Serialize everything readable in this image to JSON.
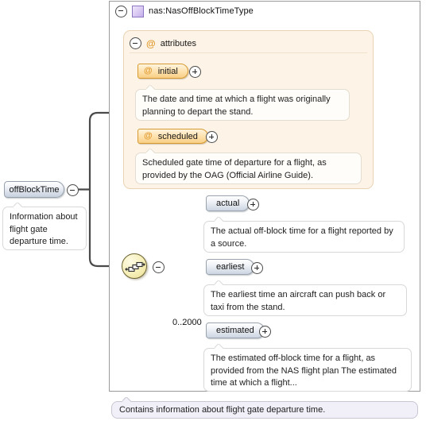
{
  "diagram": {
    "kind": "xsd-schema-diagram",
    "root_element": {
      "name": "offBlockTime",
      "documentation": "Information about flight gate departure time.",
      "toggle": "minus"
    },
    "type_box": {
      "title": "nas:NasOffBlockTimeType",
      "icon": "complex-type-icon",
      "toggle": "minus",
      "footer_documentation": "Contains information about flight gate departure time."
    },
    "attributes_group": {
      "label": "attributes",
      "toggle": "minus",
      "icon": "at-sign-icon",
      "items": [
        {
          "name": "initial",
          "toggle": "plus",
          "documentation": "The date and time at which a flight was originally planning to depart the stand."
        },
        {
          "name": "scheduled",
          "toggle": "plus",
          "documentation": "Scheduled gate time of departure for a flight, as provided by the OAG (Official Airline Guide)."
        }
      ]
    },
    "sequence": {
      "icon": "sequence-compositor-icon",
      "toggle": "minus",
      "occurrence": "0..2000",
      "children": [
        {
          "name": "actual",
          "toggle": "plus",
          "documentation": "The actual off-block time for a flight reported by a source."
        },
        {
          "name": "earliest",
          "toggle": "plus",
          "documentation": "The earliest time an aircraft can push back or taxi from the stand."
        },
        {
          "name": "estimated",
          "toggle": "plus",
          "documentation": "The estimated off-block time for a flight, as provided from the NAS flight plan The estimated time at which a flight..."
        }
      ]
    },
    "colors": {
      "attribute_accent": "#e09a2e",
      "attribute_panel_bg": "#fdf4e7",
      "element_pill_bg": "#ccd5e2",
      "complex_type_icon": "#c3adea",
      "sequence_node_bg": "#f6efb8",
      "footer_bg": "#f1eff7",
      "connector": "#808080"
    }
  }
}
